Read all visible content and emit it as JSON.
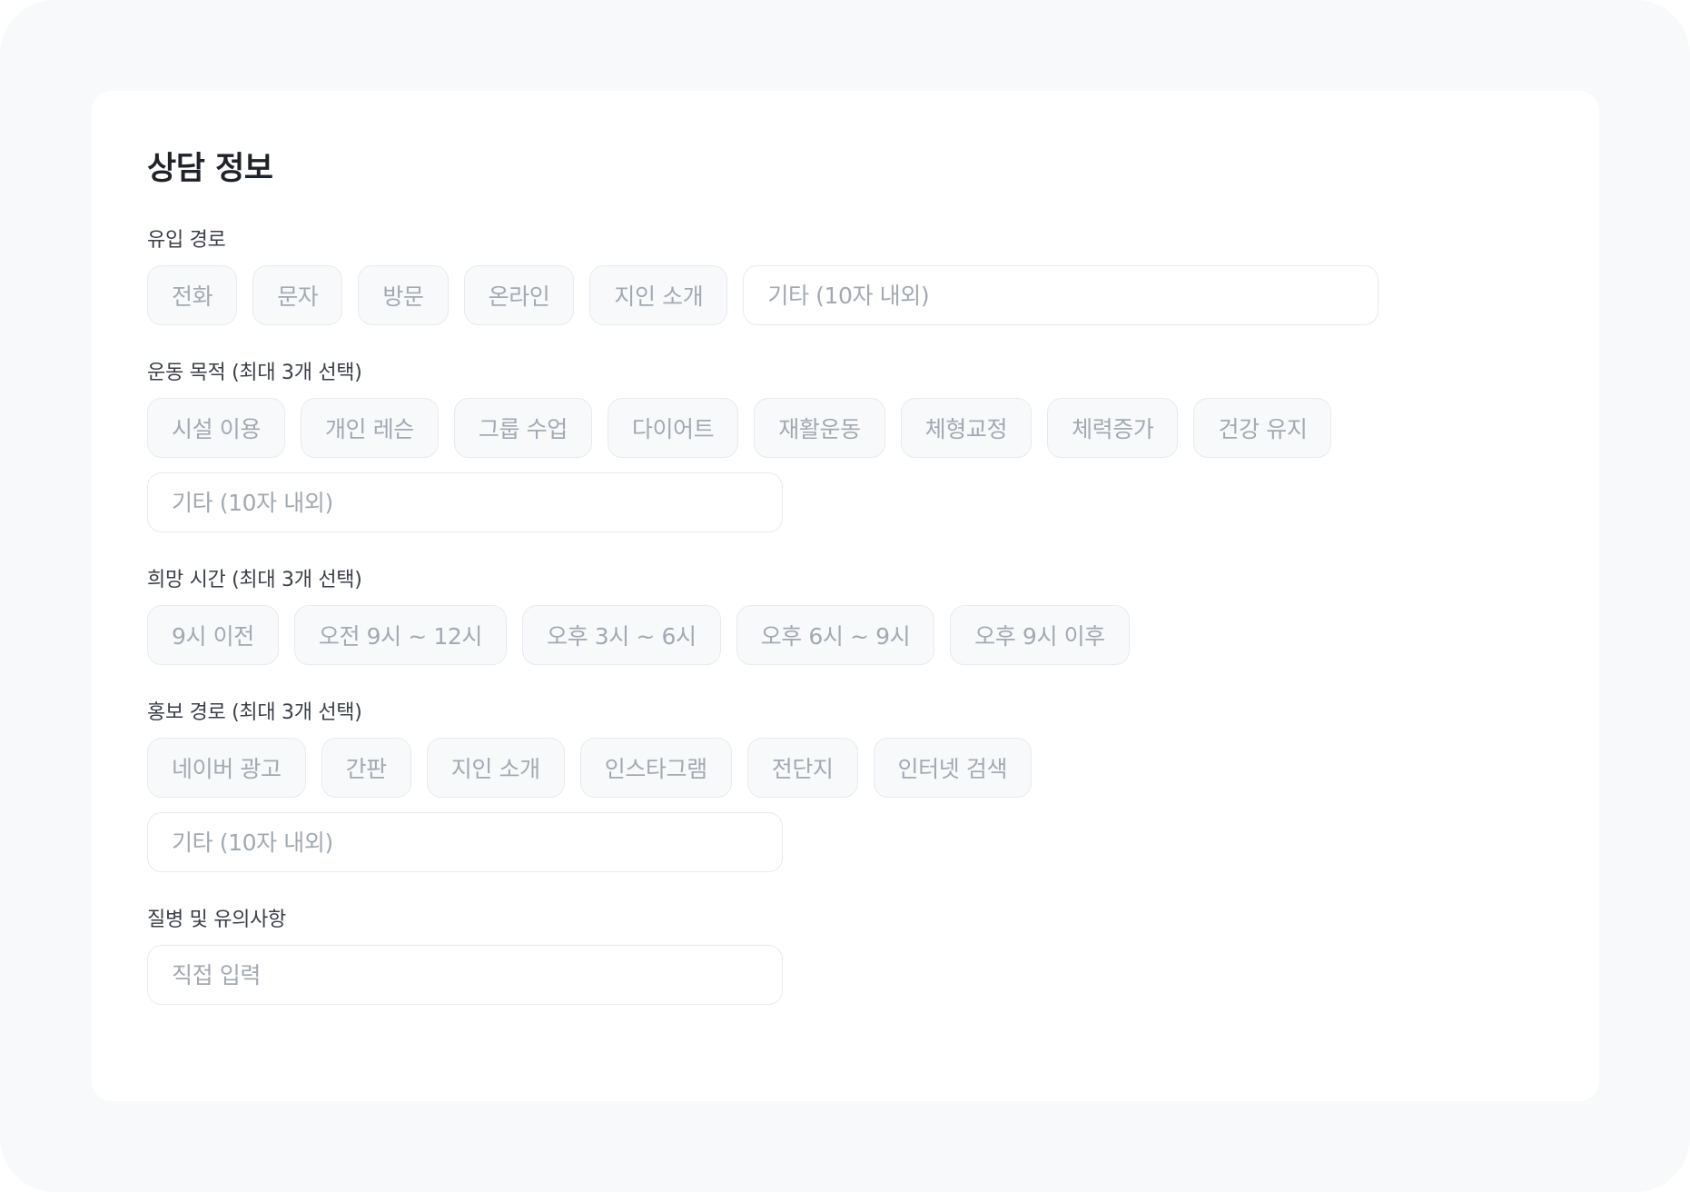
{
  "title": "상담 정보",
  "inflow": {
    "label": "유입 경로",
    "options": [
      "전화",
      "문자",
      "방문",
      "온라인",
      "지인 소개"
    ],
    "etc_placeholder": "기타 (10자 내외)"
  },
  "purpose": {
    "label": "운동 목적 (최대 3개 선택)",
    "options": [
      "시설 이용",
      "개인 레슨",
      "그룹 수업",
      "다이어트",
      "재활운동",
      "체형교정",
      "체력증가",
      "건강 유지"
    ],
    "etc_placeholder": "기타 (10자 내외)"
  },
  "time": {
    "label": "희망 시간 (최대 3개 선택)",
    "options": [
      "9시 이전",
      "오전 9시 ~ 12시",
      "오후 3시 ~ 6시",
      "오후 6시 ~ 9시",
      "오후 9시 이후"
    ]
  },
  "promotion": {
    "label": "홍보 경로 (최대 3개 선택)",
    "options": [
      "네이버 광고",
      "간판",
      "지인 소개",
      "인스타그램",
      "전단지",
      "인터넷 검색"
    ],
    "etc_placeholder": "기타 (10자 내외)"
  },
  "health": {
    "label": "질병 및 유의사항",
    "placeholder": "직접 입력"
  },
  "colors": {
    "background": "#f8f9fb",
    "card": "#ffffff",
    "chip_border": "#e8eaee",
    "chip_text": "#a3a9b2",
    "label_text": "#3a3f47",
    "title_text": "#1f2329"
  }
}
